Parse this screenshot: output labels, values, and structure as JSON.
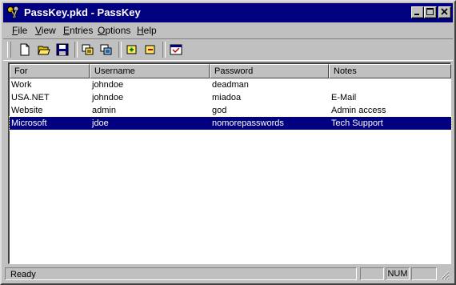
{
  "window": {
    "title": "PassKey.pkd - PassKey"
  },
  "menu": [
    {
      "label": "File",
      "u": "F",
      "rest": "ile"
    },
    {
      "label": "View",
      "u": "V",
      "rest": "iew"
    },
    {
      "label": "Entries",
      "u": "E",
      "rest": "ntries"
    },
    {
      "label": "Options",
      "u": "O",
      "rest": "ptions"
    },
    {
      "label": "Help",
      "u": "H",
      "rest": "elp"
    }
  ],
  "list": {
    "columns": [
      "For",
      "Username",
      "Password",
      "Notes"
    ],
    "rows": [
      {
        "for": "Work",
        "username": "johndoe",
        "password": "deadman",
        "notes": ""
      },
      {
        "for": "USA.NET",
        "username": "johndoe",
        "password": "miadoa",
        "notes": "E-Mail"
      },
      {
        "for": "Website",
        "username": "admin",
        "password": "god",
        "notes": "Admin access"
      },
      {
        "for": "Microsoft",
        "username": "jdoe",
        "password": "nomorepasswords",
        "notes": "Tech Support"
      }
    ],
    "selected_row": 3
  },
  "status": {
    "text": "Ready",
    "indicator": "NUM"
  },
  "colors": {
    "titlebar": "#000080",
    "selection": "#000080",
    "chrome": "#c0c0c0",
    "desktop": "#0b6b6b"
  }
}
